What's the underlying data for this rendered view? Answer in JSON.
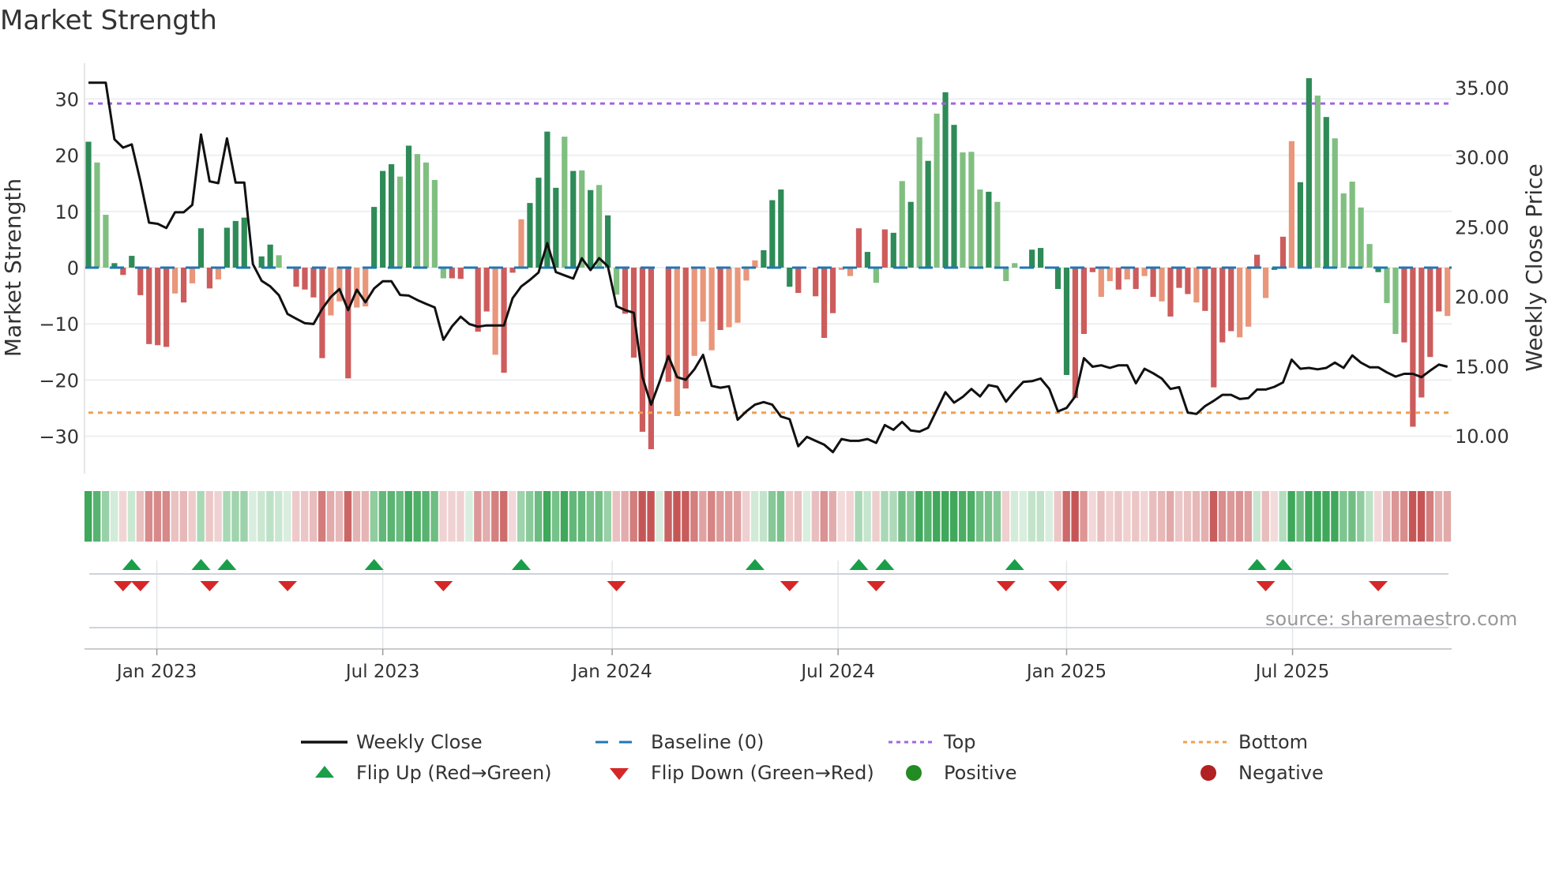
{
  "chart_data": {
    "type": "bar+line",
    "title": "Market Strength",
    "ylabel": "Market Strength",
    "y2label": "Weekly Close Price",
    "ylim": [
      -36.5,
      36.5
    ],
    "y2lim": [
      7.5,
      36.5
    ],
    "yticks": [
      30,
      20,
      10,
      0,
      -10,
      -20,
      -30
    ],
    "ytick_labels": [
      "30",
      "20",
      "10",
      "0",
      "−10",
      "−20",
      "−30"
    ],
    "y2ticks": [
      35,
      30,
      25,
      20,
      15,
      10
    ],
    "y2tick_labels": [
      "35.00",
      "30.00",
      "25.00",
      "20.00",
      "15.00",
      "10.00"
    ],
    "top_level": 29.2,
    "bottom_level": -25.8,
    "baseline": 0,
    "xticks": [
      {
        "label": "Jan 2023",
        "week": 8.9
      },
      {
        "label": "Jul 2023",
        "week": 35.0
      },
      {
        "label": "Jan 2024",
        "week": 61.5
      },
      {
        "label": "Jul 2024",
        "week": 87.6
      },
      {
        "label": "Jan 2025",
        "week": 114.0
      },
      {
        "label": "Jul 2025",
        "week": 140.1
      }
    ],
    "strength": [
      22.4,
      18.7,
      9.4,
      0.8,
      -1.3,
      2.1,
      -4.9,
      -13.6,
      -13.8,
      -14.1,
      -4.6,
      -6.2,
      -2.8,
      7.0,
      -3.7,
      -2.1,
      7.1,
      8.3,
      8.9,
      0,
      2.0,
      4.1,
      2.2,
      0,
      -3.4,
      -3.9,
      -5.3,
      -16.1,
      -8.5,
      -6.0,
      -19.7,
      -7.1,
      -6.9,
      10.8,
      17.2,
      18.4,
      16.2,
      21.7,
      20.2,
      18.7,
      15.6,
      -1.9,
      -1.9,
      -2.0,
      0,
      -11.4,
      -7.8,
      -15.5,
      -18.7,
      -0.9,
      8.6,
      11.5,
      16.0,
      24.2,
      14.2,
      23.3,
      17.2,
      17.3,
      13.8,
      14.7,
      9.3,
      -4.8,
      -8.2,
      -16.0,
      -29.2,
      -32.3,
      0,
      -20.3,
      -26.4,
      -21.5,
      -15.7,
      -9.6,
      -14.7,
      -11.1,
      -10.6,
      -9.8,
      -2.3,
      1.3,
      3.1,
      12.0,
      13.9,
      -3.4,
      -4.5,
      0,
      -5.1,
      -12.5,
      -8.1,
      -0.4,
      -1.5,
      7.0,
      2.8,
      -2.7,
      6.8,
      6.2,
      15.4,
      11.7,
      23.2,
      19.0,
      27.4,
      31.2,
      25.4,
      20.5,
      20.6,
      13.9,
      13.5,
      11.7,
      -2.4,
      0.8,
      0,
      3.2,
      3.5,
      0,
      -3.8,
      -19.1,
      -23.2,
      -11.8,
      -0.8,
      -5.2,
      -2.4,
      -3.9,
      -2.1,
      -3.8,
      -1.5,
      -5.2,
      -6.0,
      -8.7,
      -3.6,
      -4.7,
      -6.2,
      -7.7,
      -21.3,
      -13.3,
      -11.3,
      -12.4,
      -10.5,
      2.3,
      -5.4,
      -0.4,
      5.5,
      22.5,
      15.2,
      33.7,
      30.6,
      26.8,
      23.0,
      13.2,
      15.3,
      10.7,
      4.2,
      -0.8,
      -6.3,
      -11.8,
      -13.3,
      -28.3,
      -23.1,
      -15.9,
      -7.8,
      -8.6
    ],
    "strength_shade": "GggGRGRRRRrRrGRrGGGGGGgRRRRRrrRrrGGGgGggggRRRRRrRRrGGGGgGgGgGgRRRRRRrRrrrRrrrrGGGGRRRRRrrRGgRGgGgGgGGgggGgggRGGGGGRRRrrRrRrRrRRRrRRRRrrRrGRrGGgGgggggGggRRRRRrrrR",
    "weekly_close": [
      35.34,
      35.34,
      35.34,
      31.28,
      30.68,
      30.91,
      28.26,
      25.3,
      25.21,
      24.91,
      26.04,
      26.04,
      26.57,
      31.62,
      28.26,
      28.13,
      31.34,
      28.17,
      28.17,
      22.32,
      21.13,
      20.72,
      20.09,
      18.74,
      18.4,
      18.08,
      18.02,
      19.11,
      19.96,
      20.53,
      19.02,
      20.49,
      19.58,
      20.57,
      21.09,
      21.09,
      20.11,
      20.06,
      19.74,
      19.47,
      19.21,
      16.89,
      17.85,
      18.55,
      18.02,
      17.83,
      17.92,
      17.92,
      17.92,
      19.87,
      20.72,
      21.19,
      21.72,
      23.83,
      21.75,
      21.51,
      21.28,
      22.74,
      21.89,
      22.75,
      22.17,
      19.3,
      19.02,
      18.83,
      14.21,
      12.23,
      13.92,
      15.72,
      14.21,
      14.02,
      14.77,
      15.81,
      13.58,
      13.45,
      13.55,
      11.15,
      11.75,
      12.23,
      12.42,
      12.23,
      11.38,
      11.19,
      9.25,
      9.92,
      9.64,
      9.36,
      8.83,
      9.77,
      9.64,
      9.64,
      9.77,
      9.49,
      10.77,
      10.43,
      11.0,
      10.38,
      10.3,
      10.57,
      11.85,
      13.13,
      12.38,
      12.79,
      13.36,
      12.83,
      13.64,
      13.51,
      12.45,
      13.21,
      13.87,
      13.92,
      14.11,
      13.36,
      11.75,
      12.0,
      12.83,
      15.57,
      14.96,
      15.06,
      14.87,
      15.06,
      15.06,
      13.77,
      14.81,
      14.49,
      14.11,
      13.36,
      13.49,
      11.66,
      11.57,
      12.13,
      12.51,
      12.94,
      12.94,
      12.64,
      12.7,
      13.32,
      13.32,
      13.51,
      13.83,
      15.47,
      14.81,
      14.87,
      14.77,
      14.87,
      15.25,
      14.87,
      15.77,
      15.25,
      14.92,
      14.92,
      14.55,
      14.25,
      14.45,
      14.45,
      14.21,
      14.68,
      15.11,
      14.96
    ],
    "flip_up_weeks": [
      6,
      14,
      17,
      34,
      51,
      78,
      90,
      93,
      108,
      136,
      139
    ],
    "flip_down_weeks": [
      5,
      7,
      15,
      24,
      42,
      62,
      82,
      92,
      107,
      113,
      137,
      150
    ],
    "colors": {
      "strong_green": "#2e8b57",
      "light_green": "#80bf80",
      "strong_red": "#cd5c5c",
      "light_red": "#e9967a",
      "baseline": "#1f77b4",
      "top": "#a066e0",
      "bottom": "#f0a050",
      "line": "#111111",
      "flip_up": "#1a9e4a",
      "flip_down": "#d62728",
      "positive": "#228b22",
      "negative": "#b22222"
    },
    "legend": {
      "placement": "bottom",
      "items": [
        "Weekly Close",
        "Baseline (0)",
        "Top",
        "Bottom",
        "Flip Up (Red→Green)",
        "Flip Down (Green→Red)",
        "Positive",
        "Negative"
      ]
    },
    "source": "source: sharemaestro.com"
  }
}
